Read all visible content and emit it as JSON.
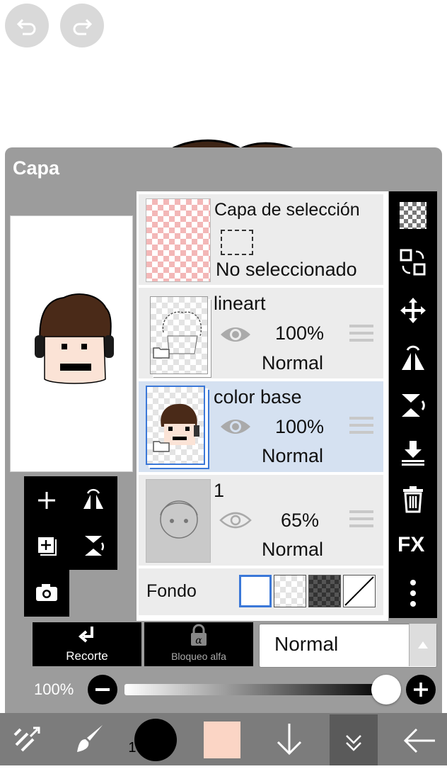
{
  "toolbar_top": {
    "undo_icon": "undo-icon",
    "redo_icon": "redo-icon"
  },
  "panel": {
    "title": "Capa",
    "selection_layer": {
      "title": "Capa de selección",
      "status": "No seleccionado"
    },
    "layers": [
      {
        "name": "lineart",
        "opacity": "100%",
        "blend": "Normal",
        "selected": false
      },
      {
        "name": "color base",
        "opacity": "100%",
        "blend": "Normal",
        "selected": true
      },
      {
        "name": "1",
        "opacity": "65%",
        "blend": "Normal",
        "selected": false
      }
    ],
    "background_label": "Fondo",
    "clipping_label": "Recorte",
    "alpha_lock_label": "Bloqueo alfa",
    "blend_mode_value": "Normal",
    "opacity_label": "100%",
    "opacity_value": 1.0,
    "fx_label": "FX"
  },
  "bottom_toolbar": {
    "brush_size": "1000.0",
    "color": "#fbd5c5"
  }
}
